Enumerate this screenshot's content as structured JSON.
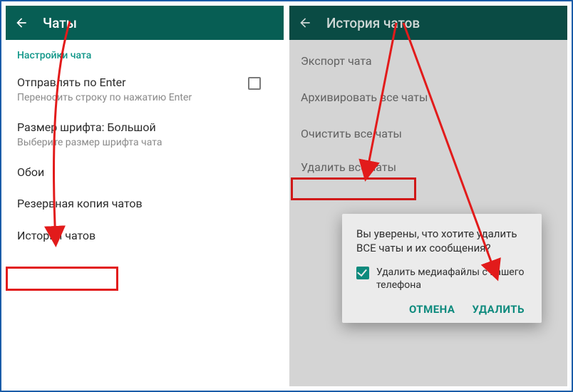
{
  "left": {
    "header_title": "Чаты",
    "section_title": "Настройки чата",
    "enter": {
      "title": "Отправлять по Enter",
      "sub": "Переносить строку по нажатию Enter"
    },
    "font": {
      "title": "Размер шрифта: Большой",
      "sub": "Выберите размер шрифта чата"
    },
    "wallpaper": "Обои",
    "backup": "Резервная копия чатов",
    "history": "История чатов"
  },
  "right": {
    "header_title": "История чатов",
    "export": "Экспорт чата",
    "archive": "Архивировать все чаты",
    "clear": "Очистить все чаты",
    "delete": "Удалить все чаты"
  },
  "dialog": {
    "text": "Вы уверены, что хотите удалить ВСЕ чаты и их сообщения?",
    "check_label": "Удалить медиафайлы с вашего телефона",
    "cancel": "ОТМЕНА",
    "confirm": "УДАЛИТЬ"
  }
}
